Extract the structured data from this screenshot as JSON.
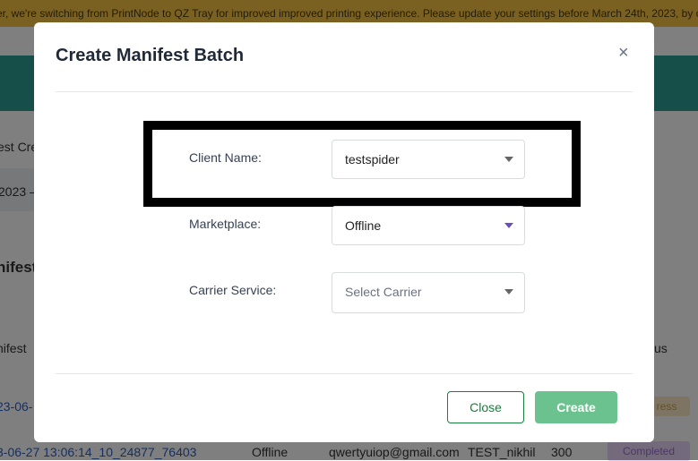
{
  "background": {
    "banner_text": "er, we're switching from PrintNode to QZ Tray for improved improved printing experience. Please update your settings before March 24th, 2023, by c",
    "fragment_1": "est Cre",
    "fragment_2": "2023 –",
    "fragment_3": "nifest",
    "fragment_4": "nifest",
    "fragment_5": "us",
    "row1_date": "23-06-",
    "badge_progress": "ress",
    "row2": {
      "id": "3-06-27 13:06:14_10_24877_76403",
      "marketplace": "Offline",
      "email": "qwertyuiop@gmail.com",
      "client": "TEST_nikhil",
      "count": "300",
      "status": "Completed"
    }
  },
  "modal": {
    "title": "Create Manifest Batch",
    "close_symbol": "×",
    "fields": {
      "client_label": "Client Name:",
      "client_value": "testspider",
      "marketplace_label": "Marketplace:",
      "marketplace_value": "Offline",
      "carrier_label": "Carrier Service:",
      "carrier_placeholder": "Select Carrier"
    },
    "buttons": {
      "close": "Close",
      "create": "Create"
    }
  },
  "colors": {
    "banner": "#f5c242",
    "header_teal": "#2d9f95",
    "close_green": "#16803c",
    "create_green": "#6cc28e"
  }
}
